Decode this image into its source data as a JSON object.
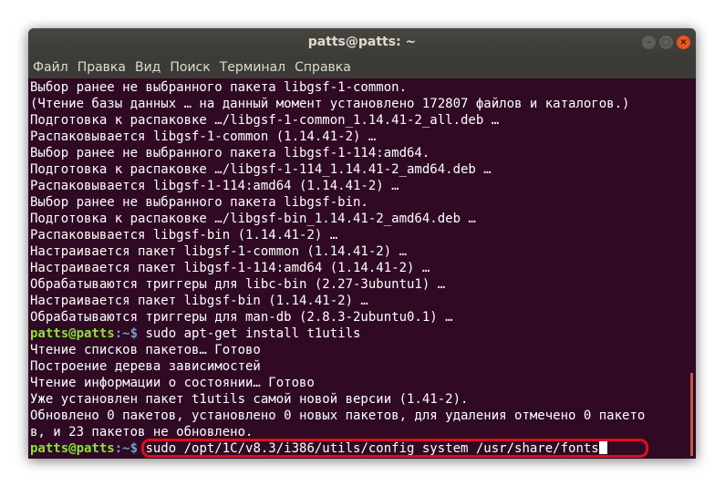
{
  "window": {
    "title": "patts@patts: ~",
    "buttons": {
      "minimize": "–",
      "maximize": "□",
      "close": "×"
    }
  },
  "menu": [
    "Файл",
    "Правка",
    "Вид",
    "Поиск",
    "Терминал",
    "Справка"
  ],
  "prompt": {
    "user": "patts@patts",
    "path": ":~$"
  },
  "terminal": {
    "output_lines": [
      "Выбор ранее не выбранного пакета libgsf-1-common.",
      "(Чтение базы данных … на данный момент установлено 172807 файлов и каталогов.)",
      "Подготовка к распаковке …/libgsf-1-common_1.14.41-2_all.deb …",
      "Распаковывается libgsf-1-common (1.14.41-2) …",
      "Выбор ранее не выбранного пакета libgsf-1-114:amd64.",
      "Подготовка к распаковке …/libgsf-1-114_1.14.41-2_amd64.deb …",
      "Распаковывается libgsf-1-114:amd64 (1.14.41-2) …",
      "Выбор ранее не выбранного пакета libgsf-bin.",
      "Подготовка к распаковке …/libgsf-bin_1.14.41-2_amd64.deb …",
      "Распаковывается libgsf-bin (1.14.41-2) …",
      "Настраивается пакет libgsf-1-common (1.14.41-2) …",
      "Настраивается пакет libgsf-1-114:amd64 (1.14.41-2) …",
      "Обрабатываются триггеры для libc-bin (2.27-3ubuntu1) …",
      "Настраивается пакет libgsf-bin (1.14.41-2) …",
      "Обрабатываются триггеры для man-db (2.8.3-2ubuntu0.1) …"
    ],
    "command1": " sudo apt-get install t1utils",
    "output_lines_2": [
      "Чтение списков пакетов… Готово",
      "Построение дерева зависимостей",
      "Чтение информации о состоянии… Готово",
      "Уже установлен пакет t1utils самой новой версии (1.41-2).",
      "Обновлено 0 пакетов, установлено 0 новых пакетов, для удаления отмечено 0 пакето",
      "в, и 23 пакетов не обновлено."
    ],
    "command2": " sudo /opt/1C/v8.3/i386/utils/config_system /usr/share/fonts"
  },
  "colors": {
    "terminal_bg": "#300a24",
    "prompt_user": "#8ae234",
    "prompt_path": "#729fcf",
    "highlight": "#e10c1a",
    "close_button": "#e95420"
  }
}
